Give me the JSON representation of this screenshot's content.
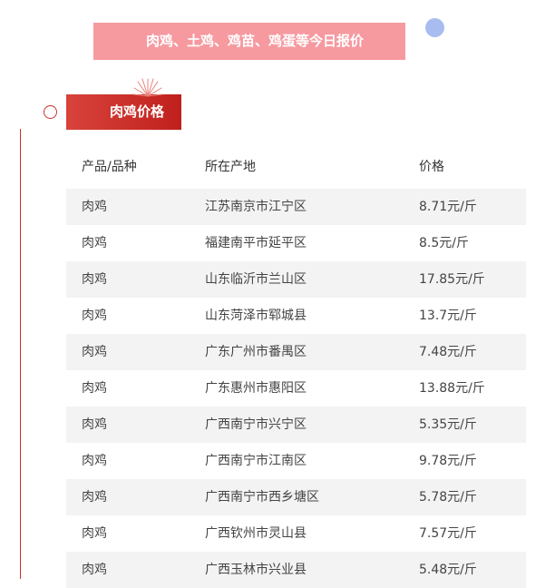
{
  "banner": {
    "title": "肉鸡、土鸡、鸡苗、鸡蛋等今日报价"
  },
  "section": {
    "title": "肉鸡价格"
  },
  "table": {
    "headers": {
      "product": "产品/品种",
      "origin": "所在产地",
      "price": "价格"
    },
    "rows": [
      {
        "product": "肉鸡",
        "origin": "江苏南京市江宁区",
        "price": "8.71元/斤"
      },
      {
        "product": "肉鸡",
        "origin": "福建南平市延平区",
        "price": "8.5元/斤"
      },
      {
        "product": "肉鸡",
        "origin": "山东临沂市兰山区",
        "price": "17.85元/斤"
      },
      {
        "product": "肉鸡",
        "origin": "山东菏泽市郓城县",
        "price": "13.7元/斤"
      },
      {
        "product": "肉鸡",
        "origin": "广东广州市番禺区",
        "price": "7.48元/斤"
      },
      {
        "product": "肉鸡",
        "origin": "广东惠州市惠阳区",
        "price": "13.88元/斤"
      },
      {
        "product": "肉鸡",
        "origin": "广西南宁市兴宁区",
        "price": "5.35元/斤"
      },
      {
        "product": "肉鸡",
        "origin": "广西南宁市江南区",
        "price": "9.78元/斤"
      },
      {
        "product": "肉鸡",
        "origin": "广西南宁市西乡塘区",
        "price": "5.78元/斤"
      },
      {
        "product": "肉鸡",
        "origin": "广西钦州市灵山县",
        "price": "7.57元/斤"
      },
      {
        "product": "肉鸡",
        "origin": "广西玉林市兴业县",
        "price": "5.48元/斤"
      }
    ]
  },
  "colors": {
    "banner_bg": "#f69aa0",
    "accent_red": "#c9302c",
    "dot_blue": "#a9bcef",
    "row_shade": "#f3f3f3"
  },
  "icons": {
    "decor_dot": "circle-dot-icon",
    "timeline_marker": "circle-outline-icon",
    "sparkle": "firework-sparkle-icon"
  }
}
